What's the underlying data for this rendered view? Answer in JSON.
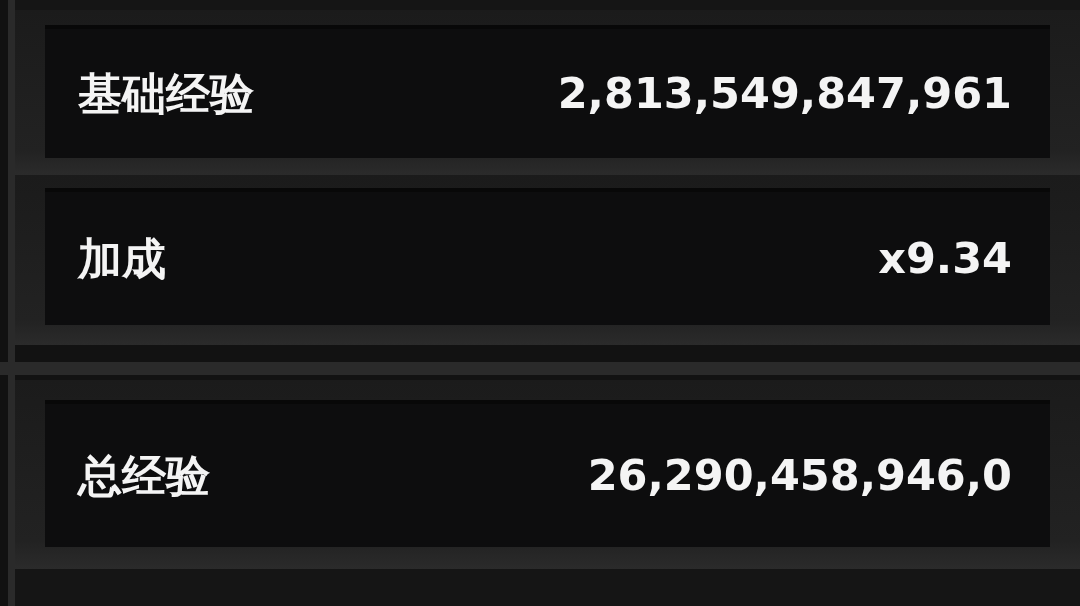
{
  "sections": [
    {
      "rows": [
        {
          "label": "基础经验",
          "value": "2,813,549,847,961"
        },
        {
          "label": "加成",
          "value": "x9.34"
        }
      ]
    },
    {
      "rows": [
        {
          "label": "总经验",
          "value": "26,290,458,946,0"
        }
      ]
    }
  ]
}
